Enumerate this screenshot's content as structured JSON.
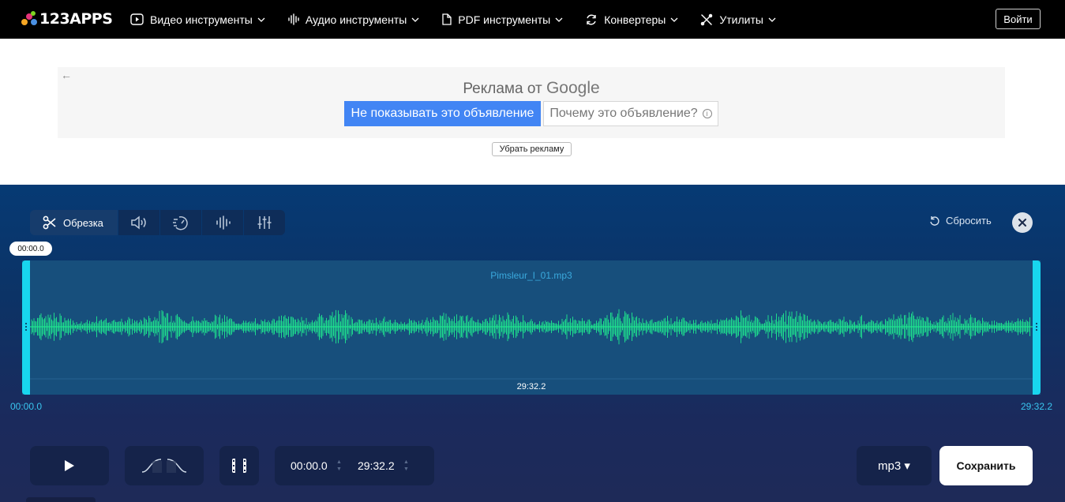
{
  "brand": {
    "name": "123APPS",
    "dot_colors": [
      "#f5a623",
      "#e5347a",
      "#4a90e2",
      "#7ed321"
    ]
  },
  "nav": {
    "items": [
      {
        "label": "Видео инструменты",
        "icon": "play-square-icon"
      },
      {
        "label": "Аудио инструменты",
        "icon": "audio-wave-icon"
      },
      {
        "label": "PDF инструменты",
        "icon": "document-icon"
      },
      {
        "label": "Конвертеры",
        "icon": "convert-cycle-icon"
      },
      {
        "label": "Утилиты",
        "icon": "tools-icon"
      }
    ],
    "login_label": "Войти"
  },
  "ad": {
    "back_arrow": "←",
    "title_prefix": "Реклама от",
    "title_brand": "Google",
    "hide_label": "Не показывать это объявление",
    "why_label": "Почему это объявление?",
    "info_glyph": "i",
    "remove_label": "Убрать рекламу"
  },
  "editor": {
    "tools": [
      {
        "label": "Обрезка",
        "icon": "scissors-icon",
        "active": true
      },
      {
        "label": "",
        "icon": "volume-icon",
        "active": false
      },
      {
        "label": "",
        "icon": "speed-icon",
        "active": false
      },
      {
        "label": "",
        "icon": "equalizer-wave-icon",
        "active": false
      },
      {
        "label": "",
        "icon": "sliders-icon",
        "active": false
      }
    ],
    "reset_label": "Сбросить",
    "cursor_time": "00:00.0",
    "file_name": "Pimsleur_I_01.mp3",
    "duration": "29:32.2",
    "range_start": "00:00.0",
    "range_end": "29:32.2",
    "colors": {
      "waveform": "#1fe38e",
      "handles": "#18d6ee",
      "panel": "#174f7c",
      "accent_text": "#39c6ef"
    },
    "controls": {
      "start_time": "00:00.0",
      "end_time": "29:32.2",
      "format": "mp3 ▾",
      "save_label": "Сохранить"
    }
  }
}
